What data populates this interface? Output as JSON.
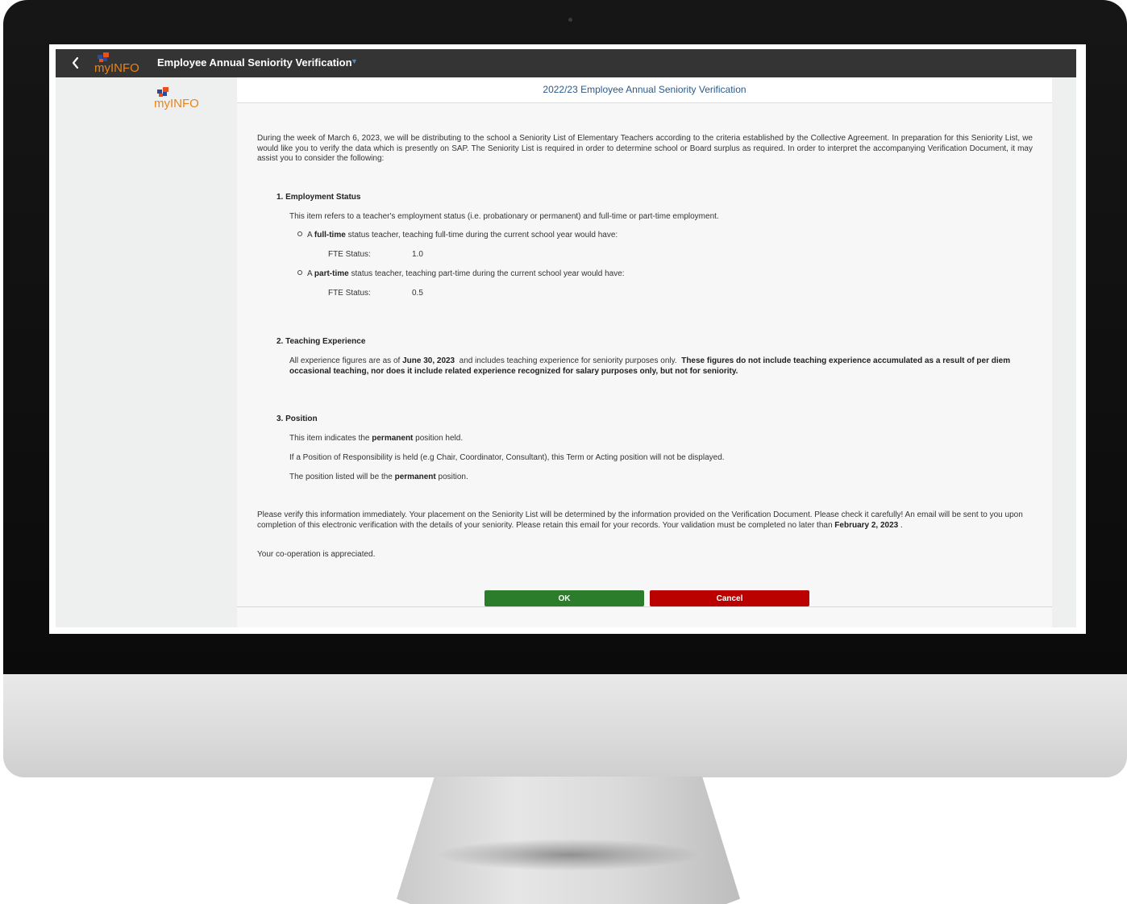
{
  "shell": {
    "logo_text": "myINFO",
    "app_title": "Employee Annual Seniority Verification"
  },
  "page": {
    "title": "2022/23 Employee Annual Seniority Verification",
    "intro": "During the week of March 6, 2023, we will be distributing to the school a Seniority List of Elementary Teachers according to the criteria established by the Collective Agreement.  In preparation for this Seniority List, we would like you to verify the data which is presently on SAP.  The Seniority List is required in order to determine school or Board surplus as required.  In order to interpret the accompanying Verification Document, it may assist you to consider the following:",
    "section1": {
      "title": "1. Employment Status",
      "desc": "This item refers to a teacher's employment status (i.e. probationary or permanent) and full-time or part-time employment.",
      "full_time": {
        "pre": "A ",
        "bold": "full-time",
        "post": " status teacher, teaching full-time during the current school year would have:",
        "fte_label": "FTE Status:",
        "fte_value": "1.0"
      },
      "part_time": {
        "pre": "A ",
        "bold": "part-time",
        "post": " status teacher, teaching part-time during the current school year would have:",
        "fte_label": "FTE Status:",
        "fte_value": "0.5"
      }
    },
    "section2": {
      "title": "2. Teaching Experience",
      "pre": "All experience figures are as of ",
      "date": "June 30, 2023",
      "mid": "  and includes teaching experience for seniority purposes only.  ",
      "bold_tail": "These figures do not include teaching experience accumulated as a result of per diem occasional teaching, nor does it include related experience recognized for salary purposes only, but not for seniority."
    },
    "section3": {
      "title": "3. Position",
      "line1_pre": "This item indicates the ",
      "line1_bold": "permanent",
      "line1_post": " position held.",
      "line2": "If a Position of Responsibility is held (e.g Chair, Coordinator, Consultant), this Term or Acting position will not be displayed.",
      "line3_pre": "The position listed will be the ",
      "line3_bold": "permanent",
      "line3_post": " position."
    },
    "closing": {
      "pre": "Please verify this information immediately. Your placement on the Seniority List will be determined by the information provided on the Verification Document.  Please check it carefully!  An email will be sent to you upon completion of this electronic verification with the details of your seniority.  Please retain this email for your records.  Your validation must be completed no later than ",
      "bold": "February 2, 2023",
      "post": " ."
    },
    "thanks": "Your co-operation is appreciated."
  },
  "buttons": {
    "ok": "OK",
    "cancel": "Cancel"
  },
  "colors": {
    "shell_bar": "#343434",
    "title_blue": "#2b5b8c",
    "ok_green": "#2b7d2b",
    "cancel_red": "#bb0000"
  }
}
